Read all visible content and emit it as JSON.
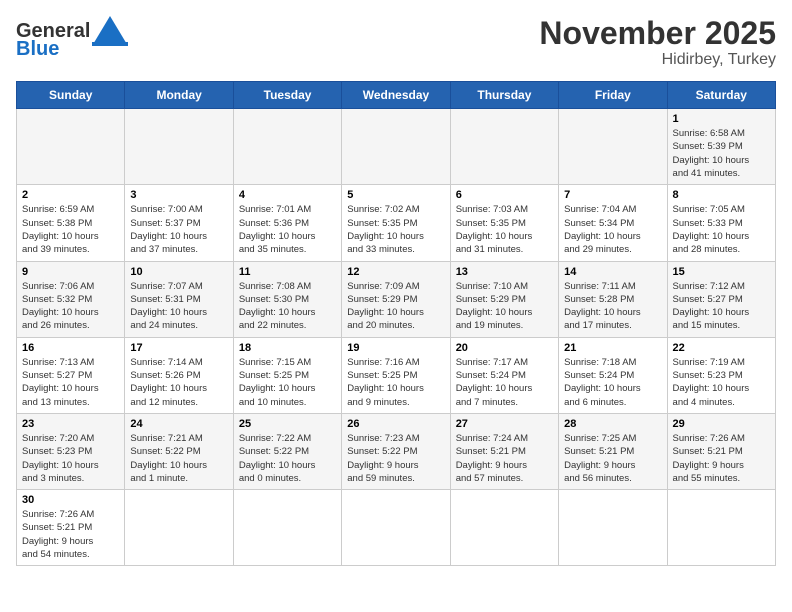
{
  "header": {
    "logo_general": "General",
    "logo_blue": "Blue",
    "title": "November 2025",
    "subtitle": "Hidirbey, Turkey"
  },
  "days_of_week": [
    "Sunday",
    "Monday",
    "Tuesday",
    "Wednesday",
    "Thursday",
    "Friday",
    "Saturday"
  ],
  "weeks": [
    [
      {
        "day": "",
        "info": ""
      },
      {
        "day": "",
        "info": ""
      },
      {
        "day": "",
        "info": ""
      },
      {
        "day": "",
        "info": ""
      },
      {
        "day": "",
        "info": ""
      },
      {
        "day": "",
        "info": ""
      },
      {
        "day": "1",
        "info": "Sunrise: 6:58 AM\nSunset: 5:39 PM\nDaylight: 10 hours\nand 41 minutes."
      }
    ],
    [
      {
        "day": "2",
        "info": "Sunrise: 6:59 AM\nSunset: 5:38 PM\nDaylight: 10 hours\nand 39 minutes."
      },
      {
        "day": "3",
        "info": "Sunrise: 7:00 AM\nSunset: 5:37 PM\nDaylight: 10 hours\nand 37 minutes."
      },
      {
        "day": "4",
        "info": "Sunrise: 7:01 AM\nSunset: 5:36 PM\nDaylight: 10 hours\nand 35 minutes."
      },
      {
        "day": "5",
        "info": "Sunrise: 7:02 AM\nSunset: 5:35 PM\nDaylight: 10 hours\nand 33 minutes."
      },
      {
        "day": "6",
        "info": "Sunrise: 7:03 AM\nSunset: 5:35 PM\nDaylight: 10 hours\nand 31 minutes."
      },
      {
        "day": "7",
        "info": "Sunrise: 7:04 AM\nSunset: 5:34 PM\nDaylight: 10 hours\nand 29 minutes."
      },
      {
        "day": "8",
        "info": "Sunrise: 7:05 AM\nSunset: 5:33 PM\nDaylight: 10 hours\nand 28 minutes."
      }
    ],
    [
      {
        "day": "9",
        "info": "Sunrise: 7:06 AM\nSunset: 5:32 PM\nDaylight: 10 hours\nand 26 minutes."
      },
      {
        "day": "10",
        "info": "Sunrise: 7:07 AM\nSunset: 5:31 PM\nDaylight: 10 hours\nand 24 minutes."
      },
      {
        "day": "11",
        "info": "Sunrise: 7:08 AM\nSunset: 5:30 PM\nDaylight: 10 hours\nand 22 minutes."
      },
      {
        "day": "12",
        "info": "Sunrise: 7:09 AM\nSunset: 5:29 PM\nDaylight: 10 hours\nand 20 minutes."
      },
      {
        "day": "13",
        "info": "Sunrise: 7:10 AM\nSunset: 5:29 PM\nDaylight: 10 hours\nand 19 minutes."
      },
      {
        "day": "14",
        "info": "Sunrise: 7:11 AM\nSunset: 5:28 PM\nDaylight: 10 hours\nand 17 minutes."
      },
      {
        "day": "15",
        "info": "Sunrise: 7:12 AM\nSunset: 5:27 PM\nDaylight: 10 hours\nand 15 minutes."
      }
    ],
    [
      {
        "day": "16",
        "info": "Sunrise: 7:13 AM\nSunset: 5:27 PM\nDaylight: 10 hours\nand 13 minutes."
      },
      {
        "day": "17",
        "info": "Sunrise: 7:14 AM\nSunset: 5:26 PM\nDaylight: 10 hours\nand 12 minutes."
      },
      {
        "day": "18",
        "info": "Sunrise: 7:15 AM\nSunset: 5:25 PM\nDaylight: 10 hours\nand 10 minutes."
      },
      {
        "day": "19",
        "info": "Sunrise: 7:16 AM\nSunset: 5:25 PM\nDaylight: 10 hours\nand 9 minutes."
      },
      {
        "day": "20",
        "info": "Sunrise: 7:17 AM\nSunset: 5:24 PM\nDaylight: 10 hours\nand 7 minutes."
      },
      {
        "day": "21",
        "info": "Sunrise: 7:18 AM\nSunset: 5:24 PM\nDaylight: 10 hours\nand 6 minutes."
      },
      {
        "day": "22",
        "info": "Sunrise: 7:19 AM\nSunset: 5:23 PM\nDaylight: 10 hours\nand 4 minutes."
      }
    ],
    [
      {
        "day": "23",
        "info": "Sunrise: 7:20 AM\nSunset: 5:23 PM\nDaylight: 10 hours\nand 3 minutes."
      },
      {
        "day": "24",
        "info": "Sunrise: 7:21 AM\nSunset: 5:22 PM\nDaylight: 10 hours\nand 1 minute."
      },
      {
        "day": "25",
        "info": "Sunrise: 7:22 AM\nSunset: 5:22 PM\nDaylight: 10 hours\nand 0 minutes."
      },
      {
        "day": "26",
        "info": "Sunrise: 7:23 AM\nSunset: 5:22 PM\nDaylight: 9 hours\nand 59 minutes."
      },
      {
        "day": "27",
        "info": "Sunrise: 7:24 AM\nSunset: 5:21 PM\nDaylight: 9 hours\nand 57 minutes."
      },
      {
        "day": "28",
        "info": "Sunrise: 7:25 AM\nSunset: 5:21 PM\nDaylight: 9 hours\nand 56 minutes."
      },
      {
        "day": "29",
        "info": "Sunrise: 7:26 AM\nSunset: 5:21 PM\nDaylight: 9 hours\nand 55 minutes."
      }
    ],
    [
      {
        "day": "30",
        "info": "Sunrise: 7:26 AM\nSunset: 5:21 PM\nDaylight: 9 hours\nand 54 minutes."
      },
      {
        "day": "",
        "info": ""
      },
      {
        "day": "",
        "info": ""
      },
      {
        "day": "",
        "info": ""
      },
      {
        "day": "",
        "info": ""
      },
      {
        "day": "",
        "info": ""
      },
      {
        "day": "",
        "info": ""
      }
    ]
  ]
}
